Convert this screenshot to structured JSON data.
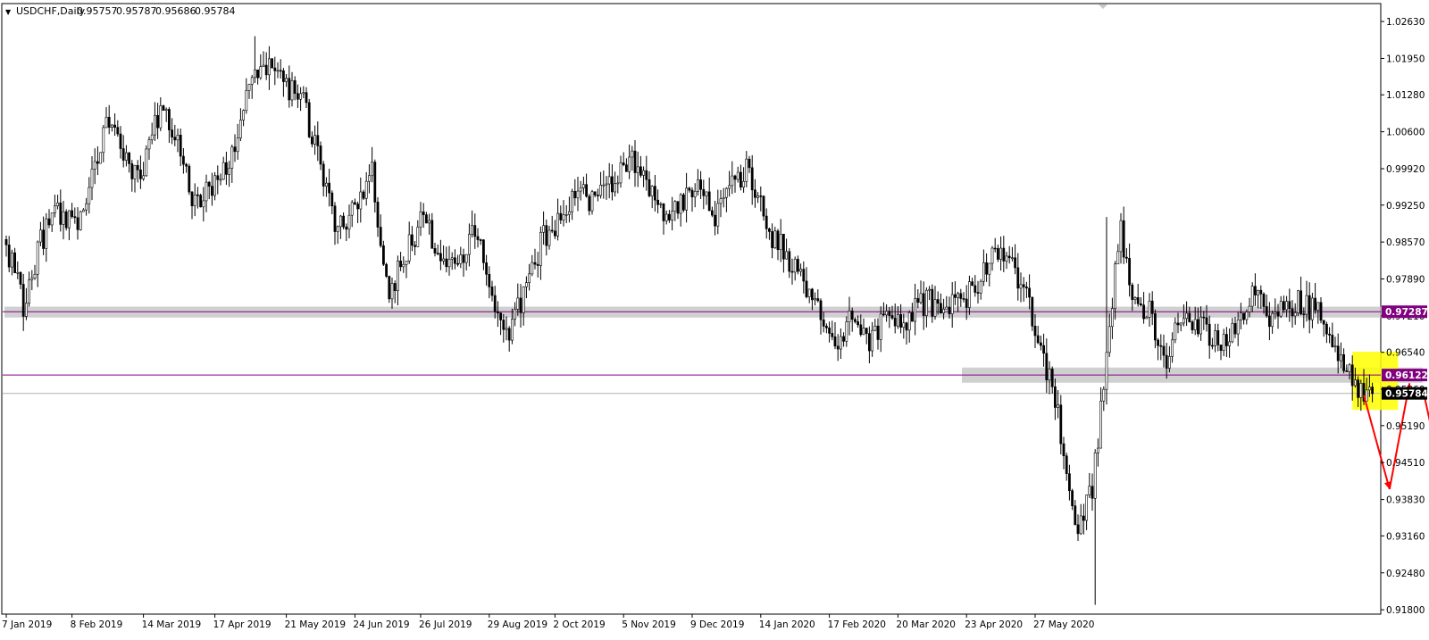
{
  "chart_data": {
    "type": "candlestick",
    "symbol_header": "USDCHF,Daily",
    "ohlc_readout": [
      "0.95757",
      "0.95787",
      "0.95686",
      "0.95784"
    ],
    "x_tick_labels": [
      "7 Jan 2019",
      "8 Feb 2019",
      "14 Mar 2019",
      "17 Apr 2019",
      "21 May 2019",
      "24 Jun 2019",
      "26 Jul 2019",
      "29 Aug 2019",
      "2 Oct 2019",
      "5 Nov 2019",
      "9 Dec 2019",
      "14 Jan 2020",
      "17 Feb 2020",
      "20 Mar 2020",
      "23 Apr 2020",
      "27 May 2020"
    ],
    "y_tick_labels": [
      "1.02630",
      "1.01950",
      "1.01280",
      "1.00600",
      "0.99920",
      "0.99250",
      "0.98570",
      "0.97890",
      "0.97210",
      "0.96540",
      "0.95860",
      "0.95190",
      "0.94510",
      "0.93830",
      "0.93160",
      "0.92480",
      "0.91800"
    ],
    "ylim": [
      0.9172,
      1.0296
    ],
    "close_path": [
      [
        0,
        0.985
      ],
      [
        6,
        0.974
      ],
      [
        12,
        0.986
      ],
      [
        18,
        0.991
      ],
      [
        25,
        0.988
      ],
      [
        30,
        0.998
      ],
      [
        36,
        1.008
      ],
      [
        42,
        1.0
      ],
      [
        48,
        0.999
      ],
      [
        54,
        1.0105
      ],
      [
        60,
        1.0045
      ],
      [
        66,
        0.9925
      ],
      [
        74,
        0.9965
      ],
      [
        80,
        1.003
      ],
      [
        86,
        1.017
      ],
      [
        92,
        1.019
      ],
      [
        98,
        1.015
      ],
      [
        104,
        1.011
      ],
      [
        110,
        1.0
      ],
      [
        116,
        0.987
      ],
      [
        122,
        0.993
      ],
      [
        128,
        0.998
      ],
      [
        134,
        0.976
      ],
      [
        140,
        0.984
      ],
      [
        146,
        0.99
      ],
      [
        152,
        0.982
      ],
      [
        158,
        0.9815
      ],
      [
        164,
        0.988
      ],
      [
        170,
        0.975
      ],
      [
        176,
        0.9685
      ],
      [
        182,
        0.9775
      ],
      [
        188,
        0.987
      ],
      [
        194,
        0.99
      ],
      [
        200,
        0.995
      ],
      [
        206,
        0.993
      ],
      [
        212,
        0.996
      ],
      [
        218,
        1.001
      ],
      [
        224,
        0.9975
      ],
      [
        230,
        0.989
      ],
      [
        236,
        0.993
      ],
      [
        242,
        0.996
      ],
      [
        248,
        0.991
      ],
      [
        254,
        0.996
      ],
      [
        260,
        0.999
      ],
      [
        266,
        0.988
      ],
      [
        272,
        0.9845
      ],
      [
        278,
        0.979
      ],
      [
        284,
        0.973
      ],
      [
        290,
        0.9665
      ],
      [
        296,
        0.9715
      ],
      [
        302,
        0.966
      ],
      [
        308,
        0.9725
      ],
      [
        314,
        0.9705
      ],
      [
        320,
        0.9745
      ],
      [
        326,
        0.9745
      ],
      [
        332,
        0.9735
      ],
      [
        338,
        0.977
      ],
      [
        344,
        0.982
      ],
      [
        350,
        0.984
      ],
      [
        356,
        0.977
      ],
      [
        362,
        0.9655
      ],
      [
        368,
        0.9545
      ],
      [
        374,
        0.9325
      ],
      [
        380,
        0.9395
      ],
      [
        386,
        0.9715
      ],
      [
        390,
        0.9875
      ],
      [
        395,
        0.9745
      ],
      [
        400,
        0.9725
      ],
      [
        406,
        0.9635
      ],
      [
        412,
        0.9735
      ],
      [
        418,
        0.9705
      ],
      [
        424,
        0.9665
      ],
      [
        430,
        0.9695
      ],
      [
        436,
        0.9775
      ],
      [
        442,
        0.9715
      ],
      [
        448,
        0.9745
      ],
      [
        454,
        0.9745
      ],
      [
        460,
        0.9725
      ],
      [
        466,
        0.965
      ],
      [
        470,
        0.9625
      ],
      [
        474,
        0.9585
      ],
      [
        478,
        0.9578
      ]
    ],
    "extremes": [
      {
        "bar": 87,
        "high": 1.0236
      },
      {
        "bar": 381,
        "low": 0.9189
      },
      {
        "bar": 385,
        "high": 0.9903
      }
    ],
    "horizontal_lines": [
      {
        "price": 0.97287,
        "label": "0.97287",
        "color": "#800080"
      },
      {
        "price": 0.96122,
        "label": "0.96122",
        "color": "#800080"
      },
      {
        "price": 0.95784,
        "label": "0.95784",
        "color": "#000000"
      }
    ],
    "zones": [
      {
        "from_bar": 0,
        "to_bar": 484,
        "price_low": 0.9718,
        "price_high": 0.9738,
        "color": "#c0c0c0"
      },
      {
        "from_bar": 335,
        "to_bar": 495,
        "price_low": 0.9598,
        "price_high": 0.9626,
        "color": "#c0c0c0"
      }
    ],
    "highlight_box": {
      "from_bar": 471,
      "to_bar": 487,
      "price_low": 0.9548,
      "price_high": 0.9655,
      "color": "#ffff00"
    },
    "projection_arrows": [
      {
        "points": [
          [
            475,
            0.9575
          ],
          [
            484,
            0.9402
          ]
        ],
        "color": "#ff0000"
      },
      {
        "points": [
          [
            484,
            0.9402
          ],
          [
            491,
            0.9597
          ]
        ],
        "color": "#ff0000"
      },
      {
        "points": [
          [
            496,
            0.9578
          ],
          [
            512,
            0.9192
          ]
        ],
        "color": "#ff0000"
      }
    ],
    "colors": {
      "candle": "#000000",
      "grid": "none",
      "axis": "#000000"
    },
    "grid": false
  }
}
